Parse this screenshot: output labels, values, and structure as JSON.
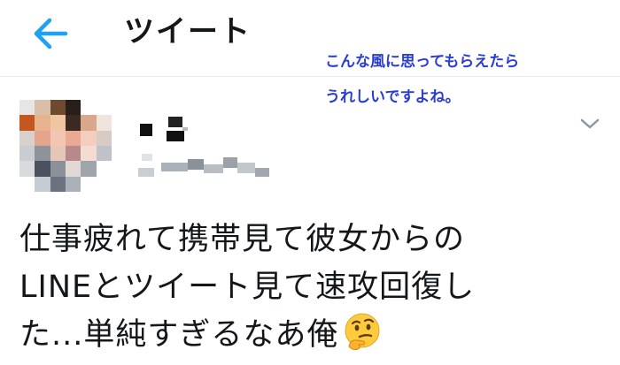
{
  "header": {
    "title": "ツイート",
    "back_icon": "arrow-left-icon",
    "accent_color": "#1da1f2"
  },
  "annotation": {
    "lines": [
      "こんな風に思ってもらえたら",
      "うれしいですよね。"
    ],
    "color": "#2a3dd1"
  },
  "tweet": {
    "avatar": "pixelated-avatar",
    "name_redacted": true,
    "handle_redacted": true,
    "menu_icon": "chevron-down-icon",
    "text_lines": [
      "仕事疲れて携帯見て彼女からの",
      "LINEとツイート見て速攻回復し",
      "た...単純すぎるなあ俺"
    ],
    "emoji": "thinking-face"
  }
}
